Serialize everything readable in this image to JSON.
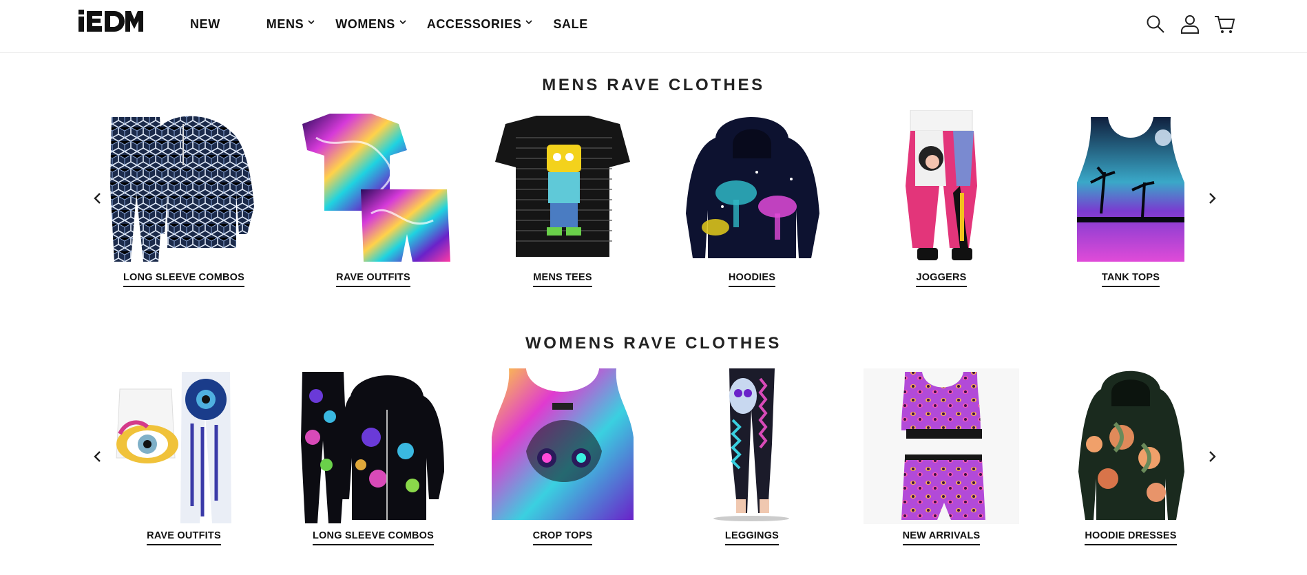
{
  "header": {
    "logo_text": "iEDM",
    "nav": [
      {
        "label": "NEW",
        "has_dropdown": false
      },
      {
        "label": "MENS",
        "has_dropdown": true
      },
      {
        "label": "WOMENS",
        "has_dropdown": true
      },
      {
        "label": "ACCESSORIES",
        "has_dropdown": true
      },
      {
        "label": "SALE",
        "has_dropdown": false
      }
    ],
    "icons": [
      "search-icon",
      "account-icon",
      "cart-icon"
    ]
  },
  "mens": {
    "title": "MENS RAVE CLOTHES",
    "items": [
      {
        "label": "LONG SLEEVE COMBOS"
      },
      {
        "label": "RAVE OUTFITS"
      },
      {
        "label": "MENS TEES"
      },
      {
        "label": "HOODIES"
      },
      {
        "label": "JOGGERS"
      },
      {
        "label": "TANK TOPS"
      }
    ]
  },
  "womens": {
    "title": "WOMENS RAVE CLOTHES",
    "items": [
      {
        "label": "RAVE OUTFITS"
      },
      {
        "label": "LONG SLEEVE COMBOS"
      },
      {
        "label": "CROP TOPS"
      },
      {
        "label": "LEGGINGS"
      },
      {
        "label": "NEW ARRIVALS"
      },
      {
        "label": "HOODIE DRESSES"
      }
    ]
  },
  "colors": {
    "text": "#111111",
    "heading": "#222222",
    "divider": "#ececec"
  }
}
